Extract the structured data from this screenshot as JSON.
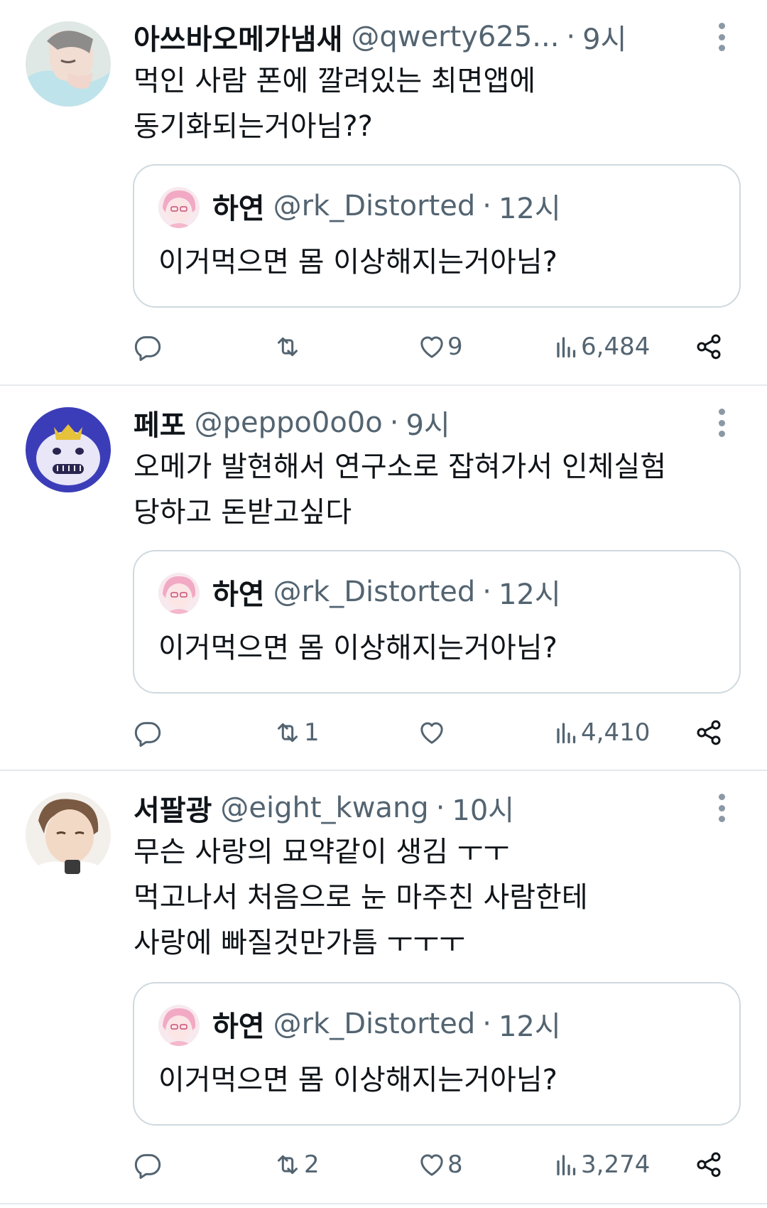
{
  "tweets": [
    {
      "author": {
        "name": "아쓰바오메가냄새",
        "handle": "@qwerty625..."
      },
      "time": "9시",
      "text_lines": [
        "먹인 사람 폰에 깔려있는 최면앱에",
        "동기화되는거아님??"
      ],
      "quote": {
        "name": "하연",
        "handle": "@rk_Distorted",
        "time": "12시",
        "text": "이거먹으면 몸 이상해지는거아님?"
      },
      "stats": {
        "replies": "",
        "retweets": "",
        "likes": "9",
        "views": "6,484"
      }
    },
    {
      "author": {
        "name": "페포",
        "handle": "@peppo0o0o"
      },
      "time": "9시",
      "text_lines": [
        "오메가 발현해서 연구소로 잡혀가서 인체실험",
        "당하고 돈받고싶다"
      ],
      "quote": {
        "name": "하연",
        "handle": "@rk_Distorted",
        "time": "12시",
        "text": "이거먹으면 몸 이상해지는거아님?"
      },
      "stats": {
        "replies": "",
        "retweets": "1",
        "likes": "",
        "views": "4,410"
      }
    },
    {
      "author": {
        "name": "서팔광",
        "handle": "@eight_kwang"
      },
      "time": "10시",
      "text_lines": [
        "무슨 사랑의 묘약같이 생김 ㅜㅜ",
        "먹고나서 처음으로 눈 마주친 사람한테",
        "사랑에 빠질것만가틈 ㅜㅜㅜ"
      ],
      "quote": {
        "name": "하연",
        "handle": "@rk_Distorted",
        "time": "12시",
        "text": "이거먹으면 몸 이상해지는거아님?"
      },
      "stats": {
        "replies": "",
        "retweets": "2",
        "likes": "8",
        "views": "3,274"
      }
    }
  ],
  "separator": "·",
  "icons": {
    "reply": "reply-icon",
    "retweet": "retweet-icon",
    "like": "heart-icon",
    "views": "views-icon",
    "share": "share-icon",
    "more": "more-options-icon"
  },
  "colors": {
    "text": "#0f1419",
    "secondary": "#536471",
    "border": "#cfd9de",
    "divider": "#e6e9ec"
  }
}
